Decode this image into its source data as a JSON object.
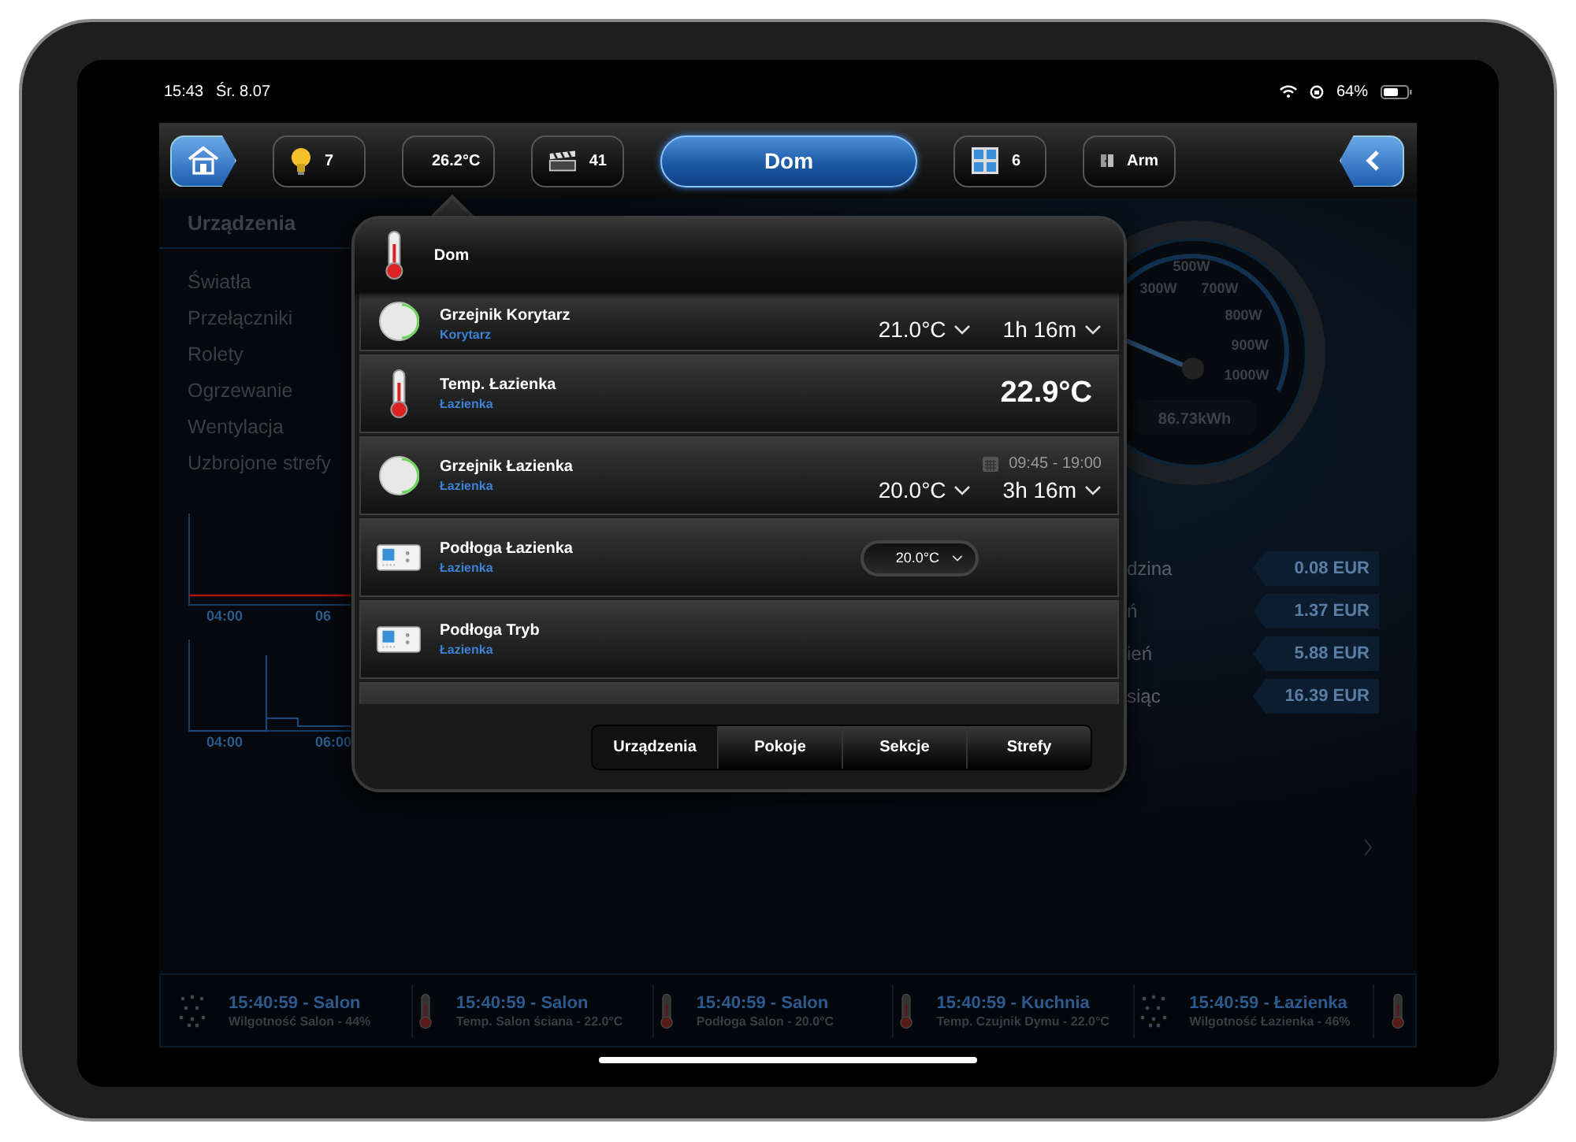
{
  "status_bar": {
    "time": "15:43",
    "date": "Śr. 8.07",
    "battery": "64%"
  },
  "toolbar": {
    "items": [
      {
        "kind": "bulb",
        "label": "7"
      },
      {
        "kind": "thermometer",
        "label": "26.2°C"
      },
      {
        "kind": "clapper",
        "label": "41"
      },
      {
        "kind": "title",
        "label": "Dom"
      },
      {
        "kind": "window",
        "label": "6"
      },
      {
        "kind": "arm",
        "label": "Arm"
      }
    ]
  },
  "sidebar": {
    "title": "Urządzenia",
    "items": [
      "Światła",
      "Przełączniki",
      "Rolety",
      "Ogrzewanie",
      "Wentylacja",
      "Uzbrojone strefy"
    ]
  },
  "charts": [
    {
      "axis_labels": [
        "04:00",
        "06"
      ]
    },
    {
      "axis_labels": [
        "04:00",
        "06:00"
      ]
    }
  ],
  "gauge": {
    "labels": [
      "500W",
      "300W",
      "700W",
      "800W",
      "900W",
      "1000W"
    ],
    "reading": "86.73kWh"
  },
  "costs": [
    {
      "label": "dzina",
      "value": "0.08 EUR"
    },
    {
      "label": "ń",
      "value": "1.37 EUR"
    },
    {
      "label": "ień",
      "value": "5.88 EUR"
    },
    {
      "label": "siąc",
      "value": "16.39 EUR"
    }
  ],
  "popover": {
    "title": "Dom",
    "rows": [
      {
        "kind": "heater",
        "name": "Grzejnik Korytarz",
        "room": "Korytarz",
        "setpoint": "21.0°C",
        "duration": "1h 16m"
      },
      {
        "kind": "thermometer",
        "name": "Temp. Łazienka",
        "room": "Łazienka",
        "value": "22.9°C"
      },
      {
        "kind": "heater",
        "name": "Grzejnik Łazienka",
        "room": "Łazienka",
        "schedule": "09:45 - 19:00",
        "setpoint": "20.0°C",
        "duration": "3h 16m"
      },
      {
        "kind": "floor",
        "name": "Podłoga Łazienka",
        "room": "Łazienka",
        "setpoint": "20.0°C"
      },
      {
        "kind": "floor",
        "name": "Podłoga Tryb",
        "room": "Łazienka"
      }
    ],
    "tabs": [
      {
        "label": "Urządzenia",
        "selected": true
      },
      {
        "label": "Pokoje",
        "selected": false
      },
      {
        "label": "Sekcje",
        "selected": false
      },
      {
        "label": "Strefy",
        "selected": false
      }
    ]
  },
  "ticker": [
    {
      "kind": "humidity",
      "time": "15:40:59 - Salon",
      "text": "Wilgotność Salon - 44%"
    },
    {
      "kind": "thermometer",
      "time": "15:40:59 - Salon",
      "text": "Temp. Salon ściana - 22.0°C"
    },
    {
      "kind": "thermometer",
      "time": "15:40:59 - Salon",
      "text": "Podłoga Salon - 20.0°C"
    },
    {
      "kind": "thermometer",
      "time": "15:40:59 - Kuchnia",
      "text": "Temp. Czujnik Dymu - 22.0°C"
    },
    {
      "kind": "humidity",
      "time": "15:40:59 - Łazienka",
      "text": "Wilgotność Łazienka - 46%"
    }
  ]
}
